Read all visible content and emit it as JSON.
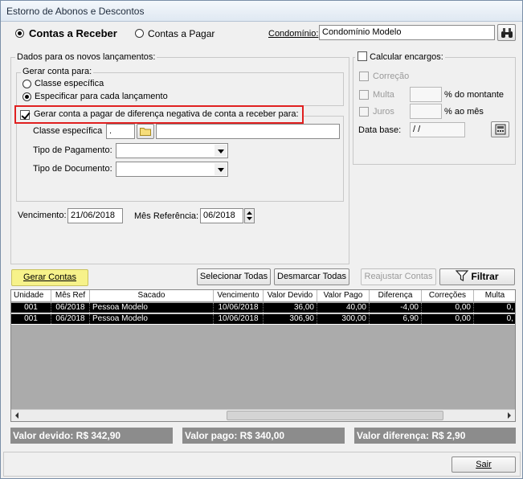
{
  "window": {
    "title": "Estorno de Abonos e Descontos"
  },
  "mode": {
    "receivable_label": "Contas a Receber",
    "payable_label": "Contas a Pagar",
    "selected": "receivable"
  },
  "condominio": {
    "label": "Condomínio:",
    "value": "Condomínio Modelo",
    "search_icon": "binoculars-icon"
  },
  "novos": {
    "group_label": "Dados para os novos lançamentos:",
    "gerar_conta_label": "Gerar conta para:",
    "opt_classe": "Classe específica",
    "opt_cada": "Especificar para cada lançamento",
    "selected": "cada",
    "gerar_negativa_label": "Gerar conta a pagar de diferença negativa de conta a receber para:",
    "gerar_negativa_checked": true,
    "classe_label": "Classe específica",
    "classe_code": ".",
    "classe_name": "",
    "tipo_pagamento_label": "Tipo de Pagamento:",
    "tipo_pagamento_value": "",
    "tipo_documento_label": "Tipo de Documento:",
    "tipo_documento_value": "",
    "vencimento_label": "Vencimento:",
    "vencimento_value": "21/06/2018",
    "mes_ref_label": "Mês Referência:",
    "mes_ref_value": "06/2018"
  },
  "encargos": {
    "label": "Calcular encargos:",
    "checked": false,
    "correcao": "Correção",
    "multa": "Multa",
    "multa_suffix": "% do montante",
    "juros": "Juros",
    "juros_suffix": "% ao mês",
    "data_base_label": "Data base:",
    "data_base_value": " / /"
  },
  "toolbar": {
    "gerar": "Gerar Contas",
    "selecionar": "Selecionar Todas",
    "desmarcar": "Desmarcar Todas",
    "reajustar": "Reajustar Contas",
    "filtrar": "Filtrar"
  },
  "grid": {
    "columns": [
      "Unidade",
      "Mês Ref",
      "Sacado",
      "Vencimento",
      "Valor Devido",
      "Valor Pago",
      "Diferença",
      "Correções",
      "Multa"
    ],
    "rows": [
      [
        "001",
        "06/2018",
        "Pessoa Modelo",
        "10/06/2018",
        "36,00",
        "40,00",
        "-4,00",
        "0,00",
        "0,"
      ],
      [
        "001",
        "06/2018",
        "Pessoa Modelo",
        "10/06/2018",
        "306,90",
        "300,00",
        "6,90",
        "0,00",
        "0,"
      ]
    ]
  },
  "totals": {
    "devido": "Valor devido: R$ 342,90",
    "pago": "Valor pago: R$ 340,00",
    "diferenca": "Valor diferença: R$ 2,90"
  },
  "footer": {
    "sair": "Sair"
  },
  "colors": {
    "highlight_box": "#e02020",
    "gerar_button_bg": "#f7f28a",
    "total_bar": "#8c8c8c"
  }
}
